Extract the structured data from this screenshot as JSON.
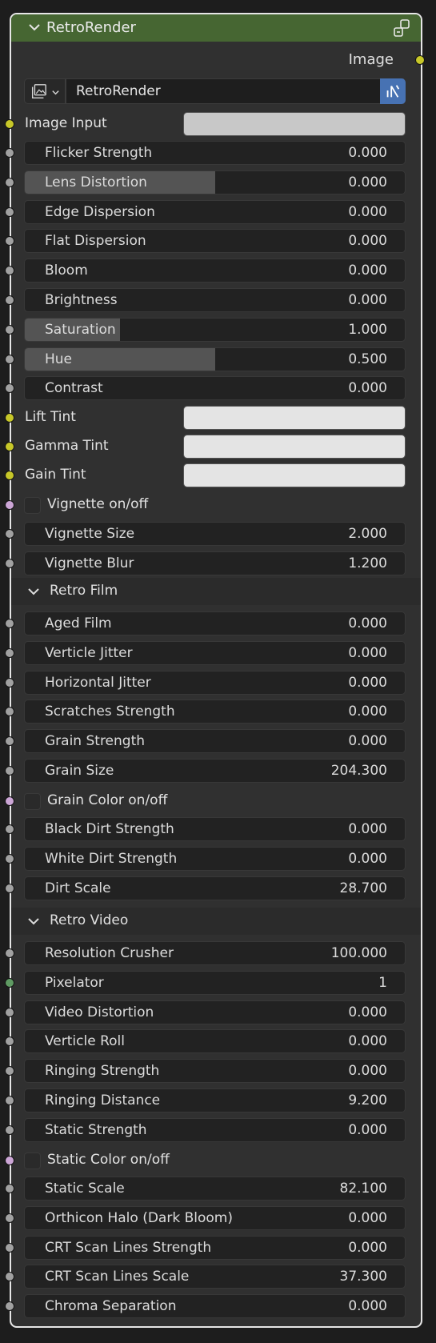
{
  "node": {
    "title": "RetroRender",
    "output_label": "Image"
  },
  "selector": {
    "name": "RetroRender"
  },
  "image_input": {
    "label": "Image Input",
    "color": "#c8c8c8"
  },
  "group1": [
    {
      "label": "Flicker Strength",
      "value": "0.000",
      "fill": 0
    },
    {
      "label": "Lens Distortion",
      "value": "0.000",
      "fill": 0.5
    },
    {
      "label": "Edge Dispersion",
      "value": "0.000",
      "fill": 0
    },
    {
      "label": "Flat Dispersion",
      "value": "0.000",
      "fill": 0
    },
    {
      "label": "Bloom",
      "value": "0.000",
      "fill": 0
    },
    {
      "label": "Brightness",
      "value": "0.000",
      "fill": 0
    },
    {
      "label": "Saturation",
      "value": "1.000",
      "fill": 0.25
    },
    {
      "label": "Hue",
      "value": "0.500",
      "fill": 0.5
    },
    {
      "label": "Contrast",
      "value": "0.000",
      "fill": 0
    }
  ],
  "tints": [
    {
      "label": "Lift Tint",
      "color": "#e4e4e4"
    },
    {
      "label": "Gamma Tint",
      "color": "#e4e4e4"
    },
    {
      "label": "Gain Tint",
      "color": "#e4e4e4"
    }
  ],
  "vignette_toggle": {
    "label": "Vignette on/off"
  },
  "vignette_fields": [
    {
      "label": "Vignette Size",
      "value": "2.000"
    },
    {
      "label": "Vignette Blur",
      "value": "1.200"
    }
  ],
  "retro_film": {
    "title": "Retro Film",
    "fields_a": [
      {
        "label": "Aged Film",
        "value": "0.000"
      },
      {
        "label": "Verticle Jitter",
        "value": "0.000"
      },
      {
        "label": "Horizontal Jitter",
        "value": "0.000"
      },
      {
        "label": "Scratches Strength",
        "value": "0.000"
      },
      {
        "label": "Grain Strength",
        "value": "0.000"
      },
      {
        "label": "Grain Size",
        "value": "204.300"
      }
    ],
    "toggle": {
      "label": "Grain Color on/off"
    },
    "fields_b": [
      {
        "label": "Black Dirt Strength",
        "value": "0.000"
      },
      {
        "label": "White Dirt Strength",
        "value": "0.000"
      },
      {
        "label": "Dirt Scale",
        "value": "28.700"
      }
    ]
  },
  "retro_video": {
    "title": "Retro Video",
    "fields_a": [
      {
        "label": "Resolution Crusher",
        "value": "100.000"
      },
      {
        "label": "Pixelator",
        "value": "1"
      },
      {
        "label": "Video Distortion",
        "value": "0.000"
      },
      {
        "label": "Verticle Roll",
        "value": "0.000"
      },
      {
        "label": "Ringing Strength",
        "value": "0.000"
      },
      {
        "label": "Ringing Distance",
        "value": "9.200"
      },
      {
        "label": "Static Strength",
        "value": "0.000"
      }
    ],
    "toggle": {
      "label": "Static Color on/off"
    },
    "fields_b": [
      {
        "label": "Static Scale",
        "value": "82.100"
      },
      {
        "label": "Orthicon Halo (Dark Bloom)",
        "value": "0.000"
      },
      {
        "label": "CRT Scan Lines Strength",
        "value": "0.000"
      },
      {
        "label": "CRT Scan Lines Scale",
        "value": "37.300"
      },
      {
        "label": "Chroma Separation",
        "value": "0.000"
      }
    ]
  },
  "socket_colors": {
    "float": "#a1a1a1",
    "color": "#c7c729",
    "bool": "#cca6d6",
    "int": "#5f9b63"
  }
}
